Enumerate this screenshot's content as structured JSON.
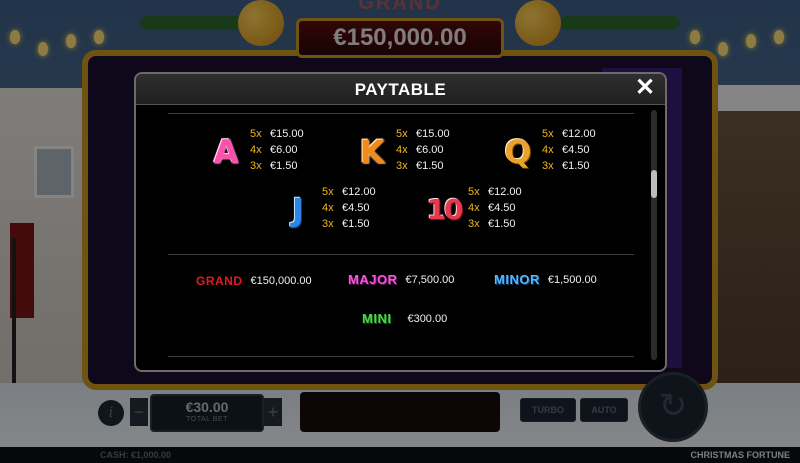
{
  "game": {
    "jackpot_top_label": "GRAND",
    "jackpot_top_value": "€150,000.00",
    "bet": {
      "value": "€30.00",
      "label": "TOTAL BET",
      "info_label": "i",
      "minus_label": "−",
      "plus_label": "+"
    },
    "turbo_label": "TURBO",
    "auto_label": "AUTO",
    "spin_icon": "↻",
    "cash_text": "CASH: €1,000.00",
    "title": "CHRISTMAS FORTUNE"
  },
  "paytable": {
    "title": "PAYTABLE",
    "close_icon": "✕",
    "symbols": [
      {
        "symbol": "A",
        "pays": [
          {
            "mult": "5x",
            "amount": "€15.00"
          },
          {
            "mult": "4x",
            "amount": "€6.00"
          },
          {
            "mult": "3x",
            "amount": "€1.50"
          }
        ]
      },
      {
        "symbol": "K",
        "pays": [
          {
            "mult": "5x",
            "amount": "€15.00"
          },
          {
            "mult": "4x",
            "amount": "€6.00"
          },
          {
            "mult": "3x",
            "amount": "€1.50"
          }
        ]
      },
      {
        "symbol": "Q",
        "pays": [
          {
            "mult": "5x",
            "amount": "€12.00"
          },
          {
            "mult": "4x",
            "amount": "€4.50"
          },
          {
            "mult": "3x",
            "amount": "€1.50"
          }
        ]
      },
      {
        "symbol": "J",
        "pays": [
          {
            "mult": "5x",
            "amount": "€12.00"
          },
          {
            "mult": "4x",
            "amount": "€4.50"
          },
          {
            "mult": "3x",
            "amount": "€1.50"
          }
        ]
      },
      {
        "symbol": "10",
        "pays": [
          {
            "mult": "5x",
            "amount": "€12.00"
          },
          {
            "mult": "4x",
            "amount": "€4.50"
          },
          {
            "mult": "3x",
            "amount": "€1.50"
          }
        ]
      }
    ],
    "jackpots": [
      {
        "name": "GRAND",
        "value": "€150,000.00"
      },
      {
        "name": "MAJOR",
        "value": "€7,500.00"
      },
      {
        "name": "MINOR",
        "value": "€1,500.00"
      },
      {
        "name": "MINI",
        "value": "€300.00"
      }
    ]
  }
}
